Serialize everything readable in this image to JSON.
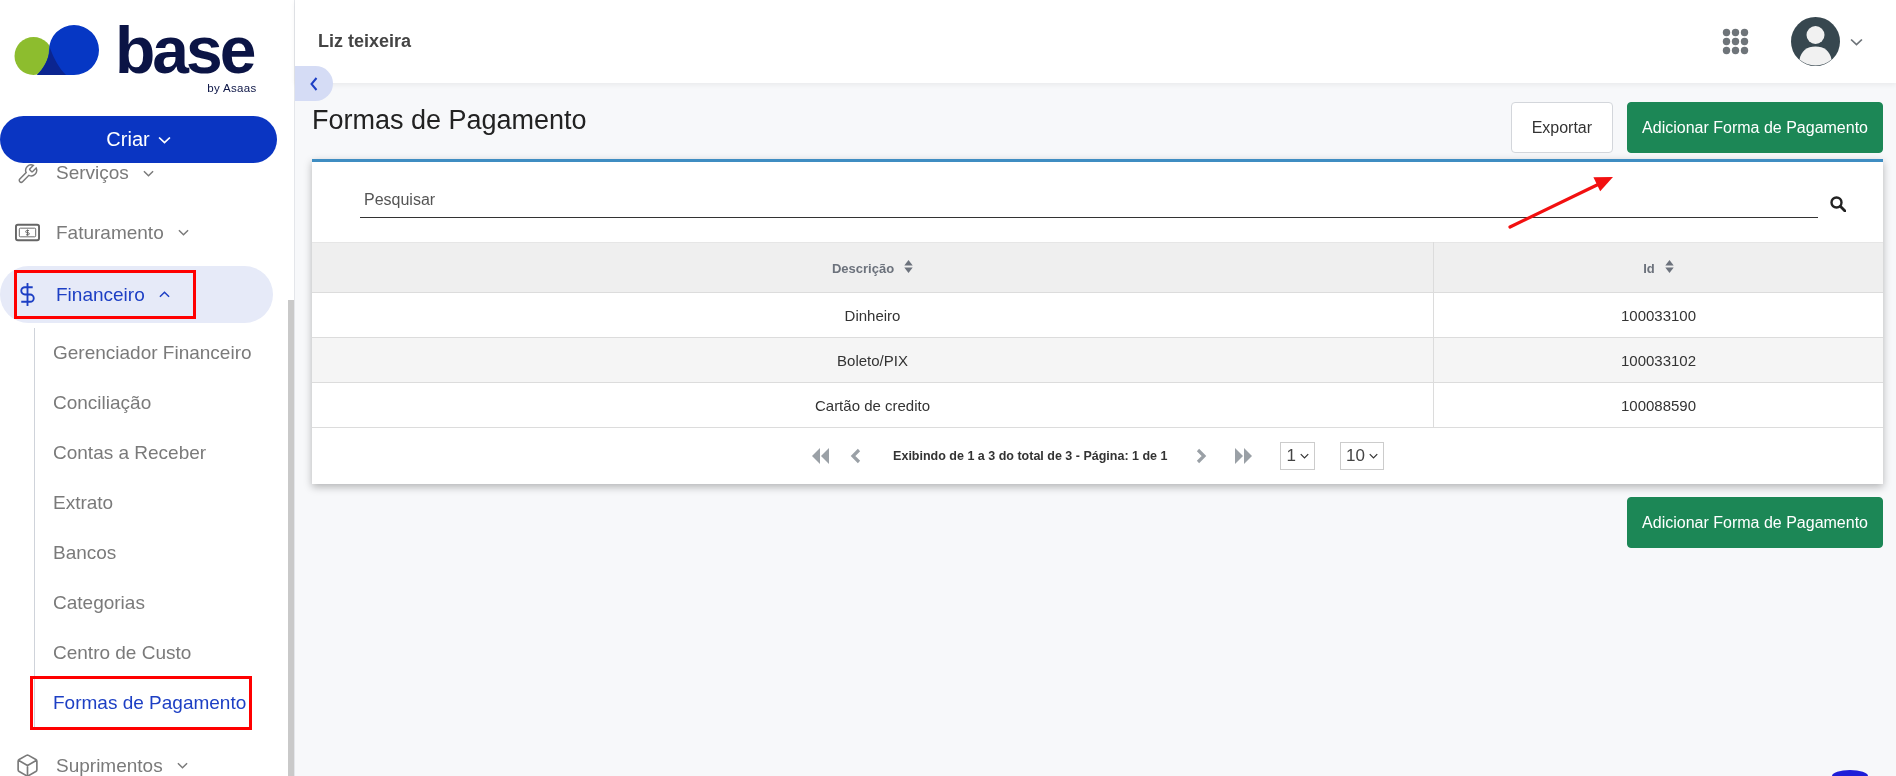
{
  "sidebar": {
    "logo": {
      "wordmark": "base",
      "tagline": "by Asaas"
    },
    "create_button": {
      "label": "Criar"
    },
    "items": [
      {
        "label": "Serviços",
        "selected": false,
        "expanded": false,
        "annotated": false
      },
      {
        "label": "Faturamento",
        "selected": false,
        "expanded": false,
        "annotated": false
      },
      {
        "label": "Financeiro",
        "selected": true,
        "expanded": true,
        "annotated": true,
        "children": [
          {
            "label": "Gerenciador Financeiro",
            "selected": false,
            "annotated": false
          },
          {
            "label": "Conciliação",
            "selected": false,
            "annotated": false
          },
          {
            "label": "Contas a Receber",
            "selected": false,
            "annotated": false
          },
          {
            "label": "Extrato",
            "selected": false,
            "annotated": false
          },
          {
            "label": "Bancos",
            "selected": false,
            "annotated": false
          },
          {
            "label": "Categorias",
            "selected": false,
            "annotated": false
          },
          {
            "label": "Centro de Custo",
            "selected": false,
            "annotated": false
          },
          {
            "label": "Formas de Pagamento",
            "selected": true,
            "annotated": true
          }
        ]
      },
      {
        "label": "Suprimentos",
        "selected": false,
        "expanded": false,
        "annotated": false
      }
    ]
  },
  "header": {
    "user_name": "Liz teixeira"
  },
  "page": {
    "title": "Formas de Pagamento",
    "actions": [
      {
        "label": "Exportar",
        "kind": "secondary"
      },
      {
        "label": "Adicionar Forma de Pagamento",
        "kind": "primary"
      }
    ],
    "annotations": [
      {
        "kind": "arrow"
      }
    ],
    "search": {
      "placeholder": "Pesquisar"
    },
    "table": {
      "columns": [
        {
          "label": "Descrição",
          "sortable": true
        },
        {
          "label": "Id",
          "sortable": true
        }
      ],
      "rows": [
        {
          "cells": [
            "Dinheiro",
            "100033100"
          ]
        },
        {
          "cells": [
            "Boleto/PIX",
            "100033102"
          ]
        },
        {
          "cells": [
            "Cartão de credito",
            "100088590"
          ]
        }
      ]
    },
    "pagination": {
      "summary": "Exibindo de 1 a 3 do total de 3 - Página: 1 de 1",
      "page": "1",
      "page_size": "10"
    },
    "footer_actions": [
      {
        "label": "Adicionar Forma de Pagamento",
        "kind": "primary"
      }
    ]
  }
}
